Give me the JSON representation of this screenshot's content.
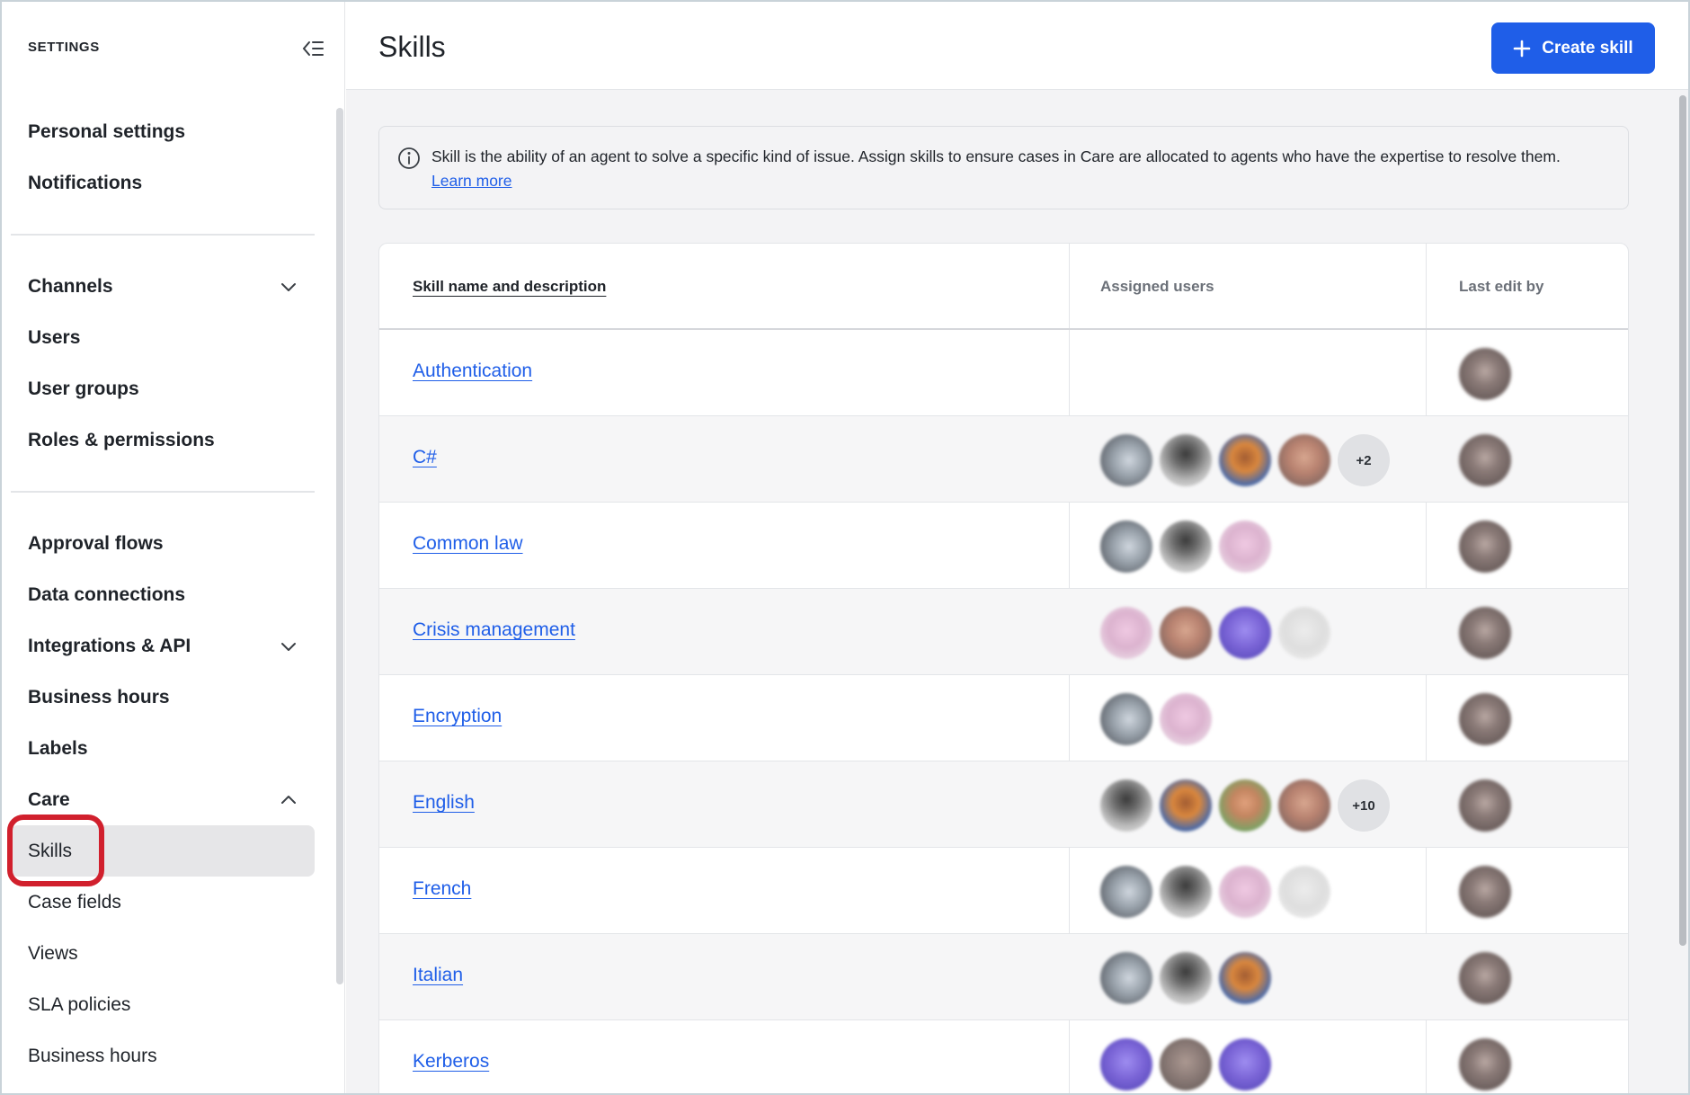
{
  "sidebar": {
    "title": "SETTINGS",
    "groups": [
      {
        "items": [
          {
            "label": "Personal settings"
          },
          {
            "label": "Notifications"
          }
        ]
      },
      {
        "items": [
          {
            "label": "Channels",
            "chevron": "chevron-down"
          },
          {
            "label": "Users"
          },
          {
            "label": "User groups"
          },
          {
            "label": "Roles & permissions"
          }
        ]
      },
      {
        "items": [
          {
            "label": "Approval flows"
          },
          {
            "label": "Data connections"
          },
          {
            "label": "Integrations & API",
            "chevron": "chevron-down"
          },
          {
            "label": "Business hours"
          },
          {
            "label": "Labels"
          },
          {
            "label": "Care",
            "chevron": "chevron-up"
          },
          {
            "label": "Skills",
            "active": true,
            "sub": true
          },
          {
            "label": "Case fields",
            "sub": true
          },
          {
            "label": "Views",
            "sub": true
          },
          {
            "label": "SLA policies",
            "sub": true
          },
          {
            "label": "Business hours",
            "sub": true
          }
        ]
      }
    ]
  },
  "header": {
    "title": "Skills",
    "create_button": "Create skill"
  },
  "info": {
    "text": "Skill is the ability of an agent to solve a specific kind of issue. Assign skills to ensure cases in Care are allocated to agents who have the expertise to resolve them.",
    "link": "Learn more"
  },
  "table": {
    "columns": [
      "Skill name and description",
      "Assigned users",
      "Last edit by"
    ],
    "rows": [
      {
        "name": "Authentication",
        "users": [],
        "more": ""
      },
      {
        "name": "C#",
        "users": [
          "gray",
          "dark",
          "orange",
          "tan"
        ],
        "more": "+2"
      },
      {
        "name": "Common law",
        "users": [
          "gray",
          "dark",
          "pink"
        ],
        "more": ""
      },
      {
        "name": "Crisis management",
        "users": [
          "pink",
          "tan",
          "purple",
          "light"
        ],
        "more": ""
      },
      {
        "name": "Encryption",
        "users": [
          "gray",
          "pink"
        ],
        "more": ""
      },
      {
        "name": "English",
        "users": [
          "dark",
          "orange",
          "green",
          "tan"
        ],
        "more": "+10"
      },
      {
        "name": "French",
        "users": [
          "gray",
          "dark",
          "pink",
          "light"
        ],
        "more": ""
      },
      {
        "name": "Italian",
        "users": [
          "gray",
          "dark",
          "orange"
        ],
        "more": ""
      },
      {
        "name": "Kerberos",
        "users": [
          "purple",
          "brown",
          "purple"
        ],
        "more": ""
      }
    ]
  },
  "colors": {
    "accent": "#1f5ee8",
    "highlight": "#d1202d",
    "active_bg": "#e6e6e8"
  }
}
